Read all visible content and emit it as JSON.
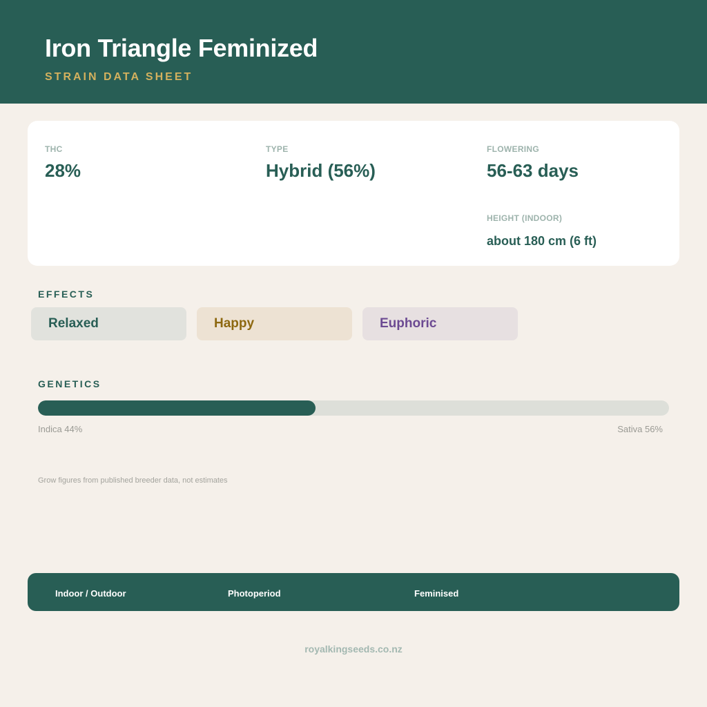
{
  "header": {
    "title": "Iron Triangle Feminized",
    "subtitle": "STRAIN DATA SHEET"
  },
  "stats": {
    "thc": {
      "label": "THC",
      "value": "28%"
    },
    "type": {
      "label": "TYPE",
      "value": "Hybrid (56%)"
    },
    "flowering": {
      "label": "FLOWERING",
      "value": "56-63 days"
    },
    "height": {
      "label": "HEIGHT (INDOOR)",
      "value": "about 180 cm (6 ft)"
    }
  },
  "effects": {
    "title": "EFFECTS",
    "items": [
      "Relaxed",
      "Happy",
      "Euphoric"
    ]
  },
  "genetics": {
    "title": "GENETICS",
    "indica_percent": 44,
    "sativa_percent": 56,
    "indica_label": "Indica 44%",
    "sativa_label": "Sativa 56%"
  },
  "note": "Grow figures from published breeder data, not estimates",
  "footer": {
    "items": [
      "Indoor / Outdoor",
      "Photoperiod",
      "Feminised"
    ]
  },
  "website": "royalkingseeds.co.nz",
  "colors": {
    "primary": "#285e55",
    "accent": "#d4b15e",
    "background": "#f5f0ea"
  }
}
